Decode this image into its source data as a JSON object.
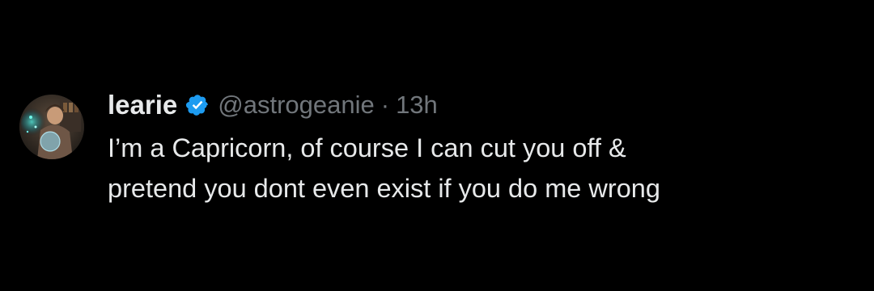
{
  "tweet": {
    "display_name": "learie",
    "verified_icon": "verified-badge-icon",
    "handle": "@astrogeanie",
    "separator": "·",
    "time": "13h",
    "text_lines": [
      "I’m a Capricorn, of course I can cut you off &",
      "pretend you dont even exist if you do me wrong"
    ]
  },
  "colors": {
    "background": "#000000",
    "primary_text": "#e7e9ea",
    "secondary_text": "#71767b",
    "verified_blue": "#1d9bf0"
  }
}
